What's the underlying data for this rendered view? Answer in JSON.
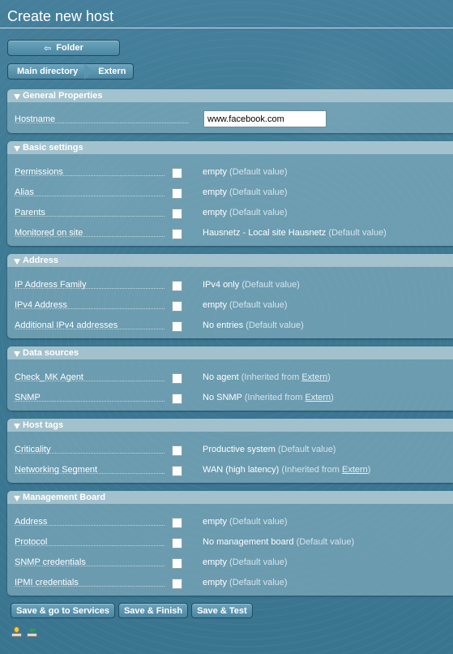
{
  "title": "Create new host",
  "folder_button": "Folder",
  "breadcrumb": [
    "Main directory",
    "Extern"
  ],
  "general": {
    "header": "General Properties",
    "hostname_label": "Hostname",
    "hostname_value": "www.facebook.com"
  },
  "basic": {
    "header": "Basic settings",
    "rows": [
      {
        "label": "Permissions",
        "value": "empty",
        "note": "(Default value)"
      },
      {
        "label": "Alias",
        "value": "empty",
        "note": "(Default value)"
      },
      {
        "label": "Parents",
        "value": "empty",
        "note": "(Default value)"
      },
      {
        "label": "Monitored on site",
        "value": "Hausnetz - Local site Hausnetz",
        "note": "(Default value)"
      }
    ]
  },
  "address": {
    "header": "Address",
    "rows": [
      {
        "label": "IP Address Family",
        "value": "IPv4 only",
        "note": "(Default value)"
      },
      {
        "label": "IPv4 Address",
        "value": "empty",
        "note": "(Default value)"
      },
      {
        "label": "Additional IPv4 addresses",
        "value": "No entries",
        "note": "(Default value)"
      }
    ]
  },
  "datasources": {
    "header": "Data sources",
    "rows": [
      {
        "label": "Check_MK Agent",
        "value": "No agent",
        "note_pre": "(Inherited from",
        "link": "Extern",
        "note_post": ")"
      },
      {
        "label": "SNMP",
        "value": "No SNMP",
        "note_pre": "(Inherited from",
        "link": "Extern",
        "note_post": ")"
      }
    ]
  },
  "hosttags": {
    "header": "Host tags",
    "rows": [
      {
        "label": "Criticality",
        "value": "Productive system",
        "note": "(Default value)"
      },
      {
        "label": "Networking Segment",
        "value": "WAN (high latency)",
        "note_pre": "(Inherited from",
        "link": "Extern",
        "note_post": ")"
      }
    ]
  },
  "mgmt": {
    "header": "Management Board",
    "rows": [
      {
        "label": "Address",
        "value": "empty",
        "note": "(Default value)"
      },
      {
        "label": "Protocol",
        "value": "No management board",
        "note": "(Default value)"
      },
      {
        "label": "SNMP credentials",
        "value": "empty",
        "note": "(Default value)"
      },
      {
        "label": "IPMI credentials",
        "value": "empty",
        "note": "(Default value)"
      }
    ]
  },
  "buttons": {
    "save_services": "Save & go to Services",
    "save_finish": "Save & Finish",
    "save_test": "Save & Test"
  },
  "icons": [
    "host-icon",
    "network-icon"
  ]
}
